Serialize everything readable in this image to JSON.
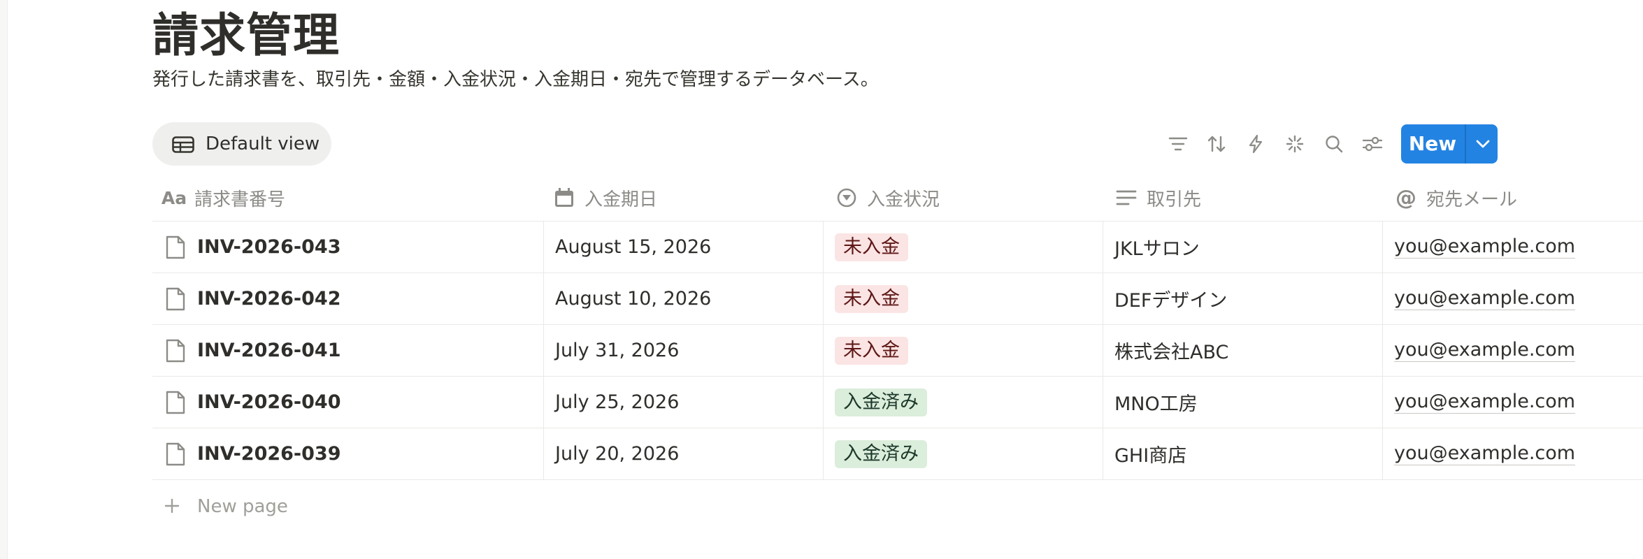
{
  "page": {
    "title": "請求管理",
    "description": "発行した請求書を、取引先・金額・入金状況・入金期日・宛先で管理するデータベース。"
  },
  "view": {
    "label": "Default view",
    "icon": "table-icon"
  },
  "toolbar": {
    "icons": [
      "filter-icon",
      "sort-icon",
      "automation-icon",
      "ai-sparkle-icon",
      "search-icon",
      "settings-icon"
    ],
    "new_label": "New",
    "accent": "#2383e2"
  },
  "columns": [
    {
      "label": "請求書番号",
      "icon": "Aa"
    },
    {
      "label": "入金期日",
      "icon": "calendar-icon"
    },
    {
      "label": "入金状況",
      "icon": "status-icon"
    },
    {
      "label": "取引先",
      "icon": "text-icon"
    },
    {
      "label": "宛先メール",
      "icon": "at-icon"
    }
  ],
  "rows": [
    {
      "invoice": "INV-2026-043",
      "due": "August 15, 2026",
      "status": "未入金",
      "client": "JKLサロン",
      "email": "you@example.com"
    },
    {
      "invoice": "INV-2026-042",
      "due": "August 10, 2026",
      "status": "未入金",
      "client": "DEFデザイン",
      "email": "you@example.com"
    },
    {
      "invoice": "INV-2026-041",
      "due": "July 31, 2026",
      "status": "未入金",
      "client": "株式会社ABC",
      "email": "you@example.com"
    },
    {
      "invoice": "INV-2026-040",
      "due": "July 25, 2026",
      "status": "入金済み",
      "client": "MNO工房",
      "email": "you@example.com"
    },
    {
      "invoice": "INV-2026-039",
      "due": "July 20, 2026",
      "status": "入金済み",
      "client": "GHI商店",
      "email": "you@example.com"
    }
  ],
  "status_colors": {
    "未入金": {
      "bg": "#fbe4e4",
      "fg": "#5d1715"
    },
    "入金済み": {
      "bg": "#dbeddb",
      "fg": "#1c3829"
    }
  },
  "new_page_label": "New page"
}
